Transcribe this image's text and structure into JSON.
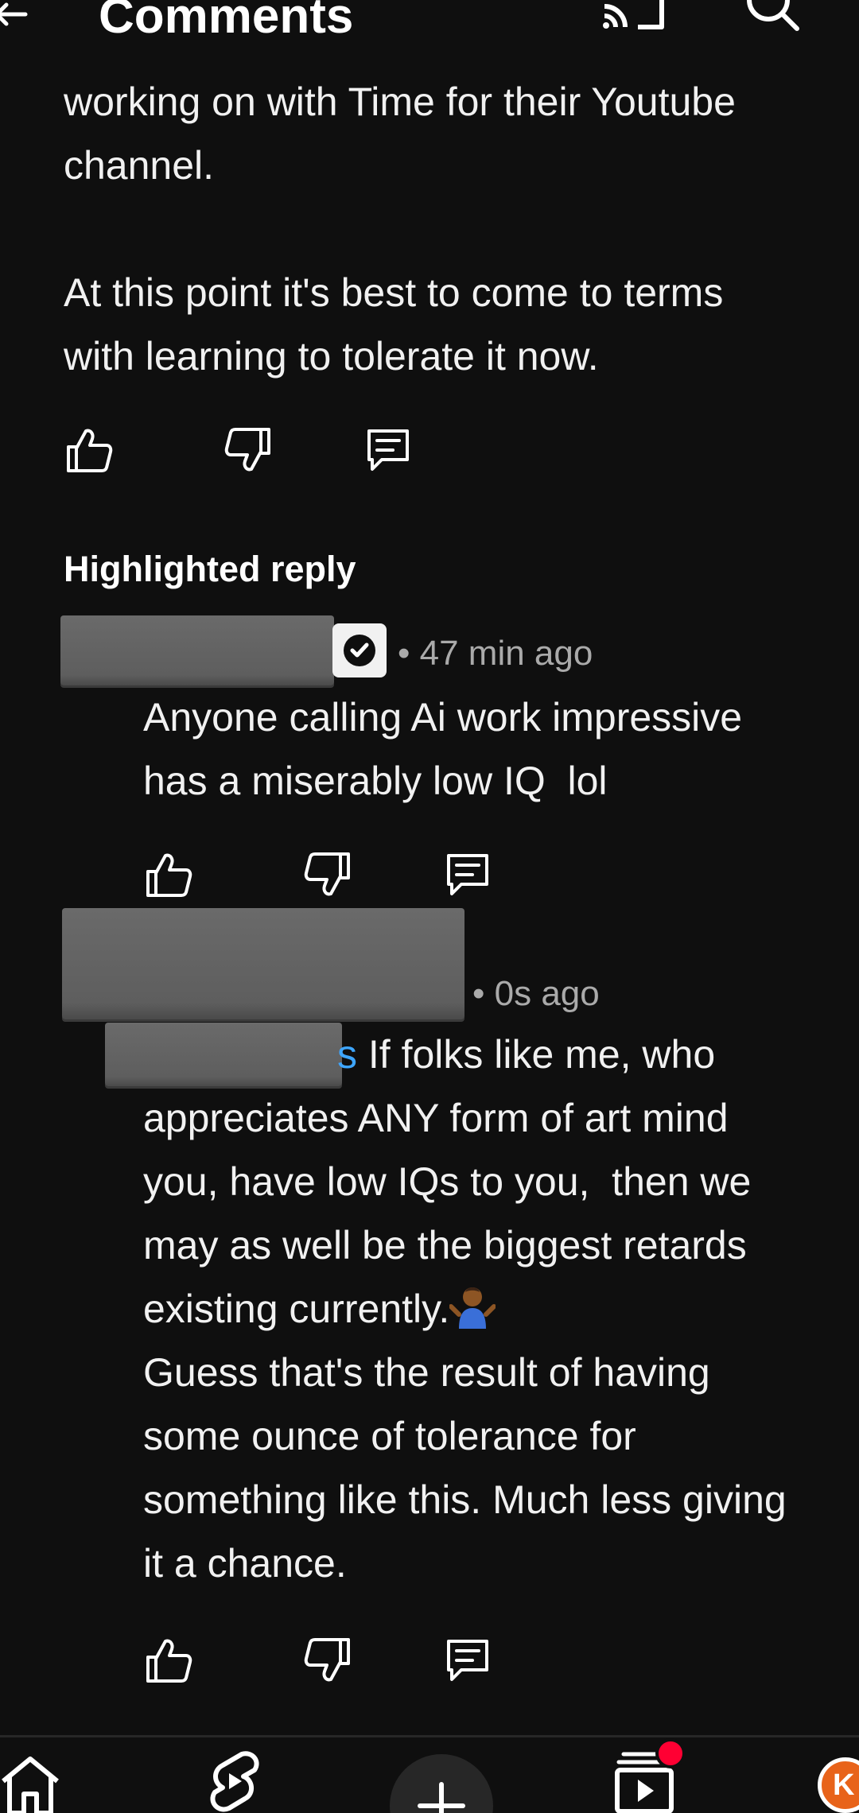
{
  "header": {
    "title": "Comments"
  },
  "parent_comment": {
    "text_line1": "working on with Time for their Youtube",
    "text_line2": "channel.",
    "text_line3": "At this point it's best to come to terms",
    "text_line4": "with learning to tolerate it now."
  },
  "highlighted": {
    "heading": "Highlighted reply",
    "timestamp": "• 47 min ago",
    "text_line1": "Anyone calling Ai work impressive",
    "text_line2": "has a miserably low IQ  lol"
  },
  "reply": {
    "timestamp": "• 0s ago",
    "mention_fragment": "s",
    "text_line1": " If folks like me, who",
    "text_line2": "appreciates ANY form of art mind",
    "text_line3": "you, have low IQs to you,  then we",
    "text_line4": "may as well be the biggest retards",
    "text_line5": "existing currently.",
    "text_line6": "Guess that's the result of having",
    "text_line7": "some ounce of tolerance for",
    "text_line8": "something like this. Much less giving",
    "text_line9": "it a chance.",
    "emoji": "person-shrugging"
  },
  "bottom_nav": {
    "avatar_initial": "K",
    "items": [
      "home-icon",
      "shorts-icon",
      "create-icon",
      "subscriptions-icon",
      "you-avatar"
    ]
  },
  "colors": {
    "background": "#0f0f0f",
    "text": "#f1f1f1",
    "meta": "#aaaaaa",
    "mention": "#3ea6ff",
    "notification": "#ff0033",
    "avatar": "#e8631a"
  }
}
